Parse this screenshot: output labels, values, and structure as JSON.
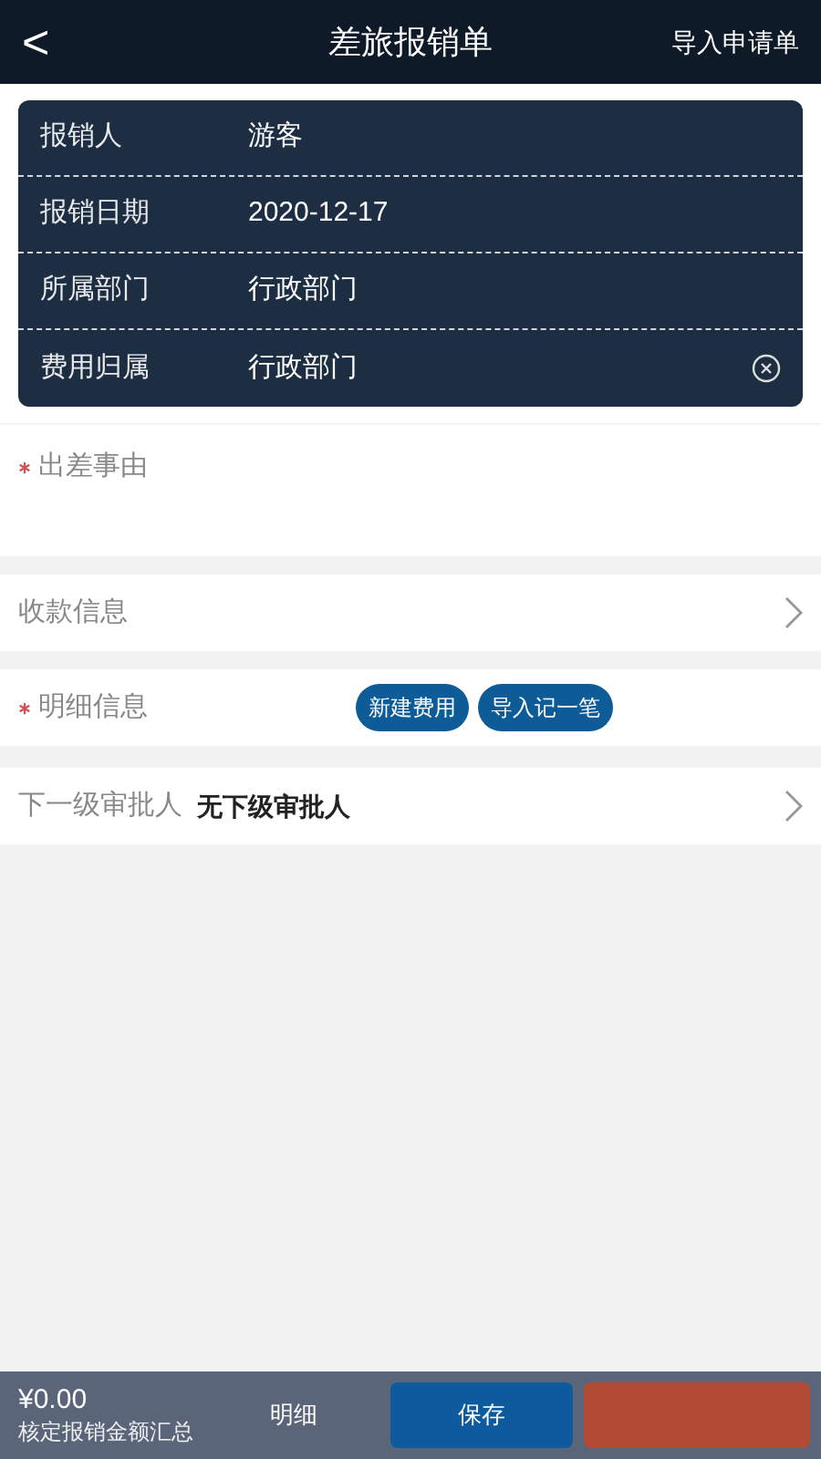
{
  "header": {
    "back": "<",
    "title": "差旅报销单",
    "action": "导入申请单"
  },
  "info_rows": [
    {
      "label": "报销人",
      "value": "游客",
      "clearable": false
    },
    {
      "label": "报销日期",
      "value": "2020-12-17",
      "clearable": false
    },
    {
      "label": "所属部门",
      "value": "行政部门",
      "clearable": false
    },
    {
      "label": "费用归属",
      "value": "行政部门",
      "clearable": true
    }
  ],
  "reason": {
    "label": "出差事由",
    "required": true
  },
  "payment": {
    "label": "收款信息"
  },
  "details": {
    "label": "明细信息",
    "required": true,
    "buttons": [
      "新建费用",
      "导入记一笔"
    ]
  },
  "approver": {
    "label": "下一级审批人",
    "value": "无下级审批人"
  },
  "footer": {
    "amount": "¥0.00",
    "amount_label": "核定报销金额汇总",
    "details": "明细",
    "save": "保存"
  }
}
